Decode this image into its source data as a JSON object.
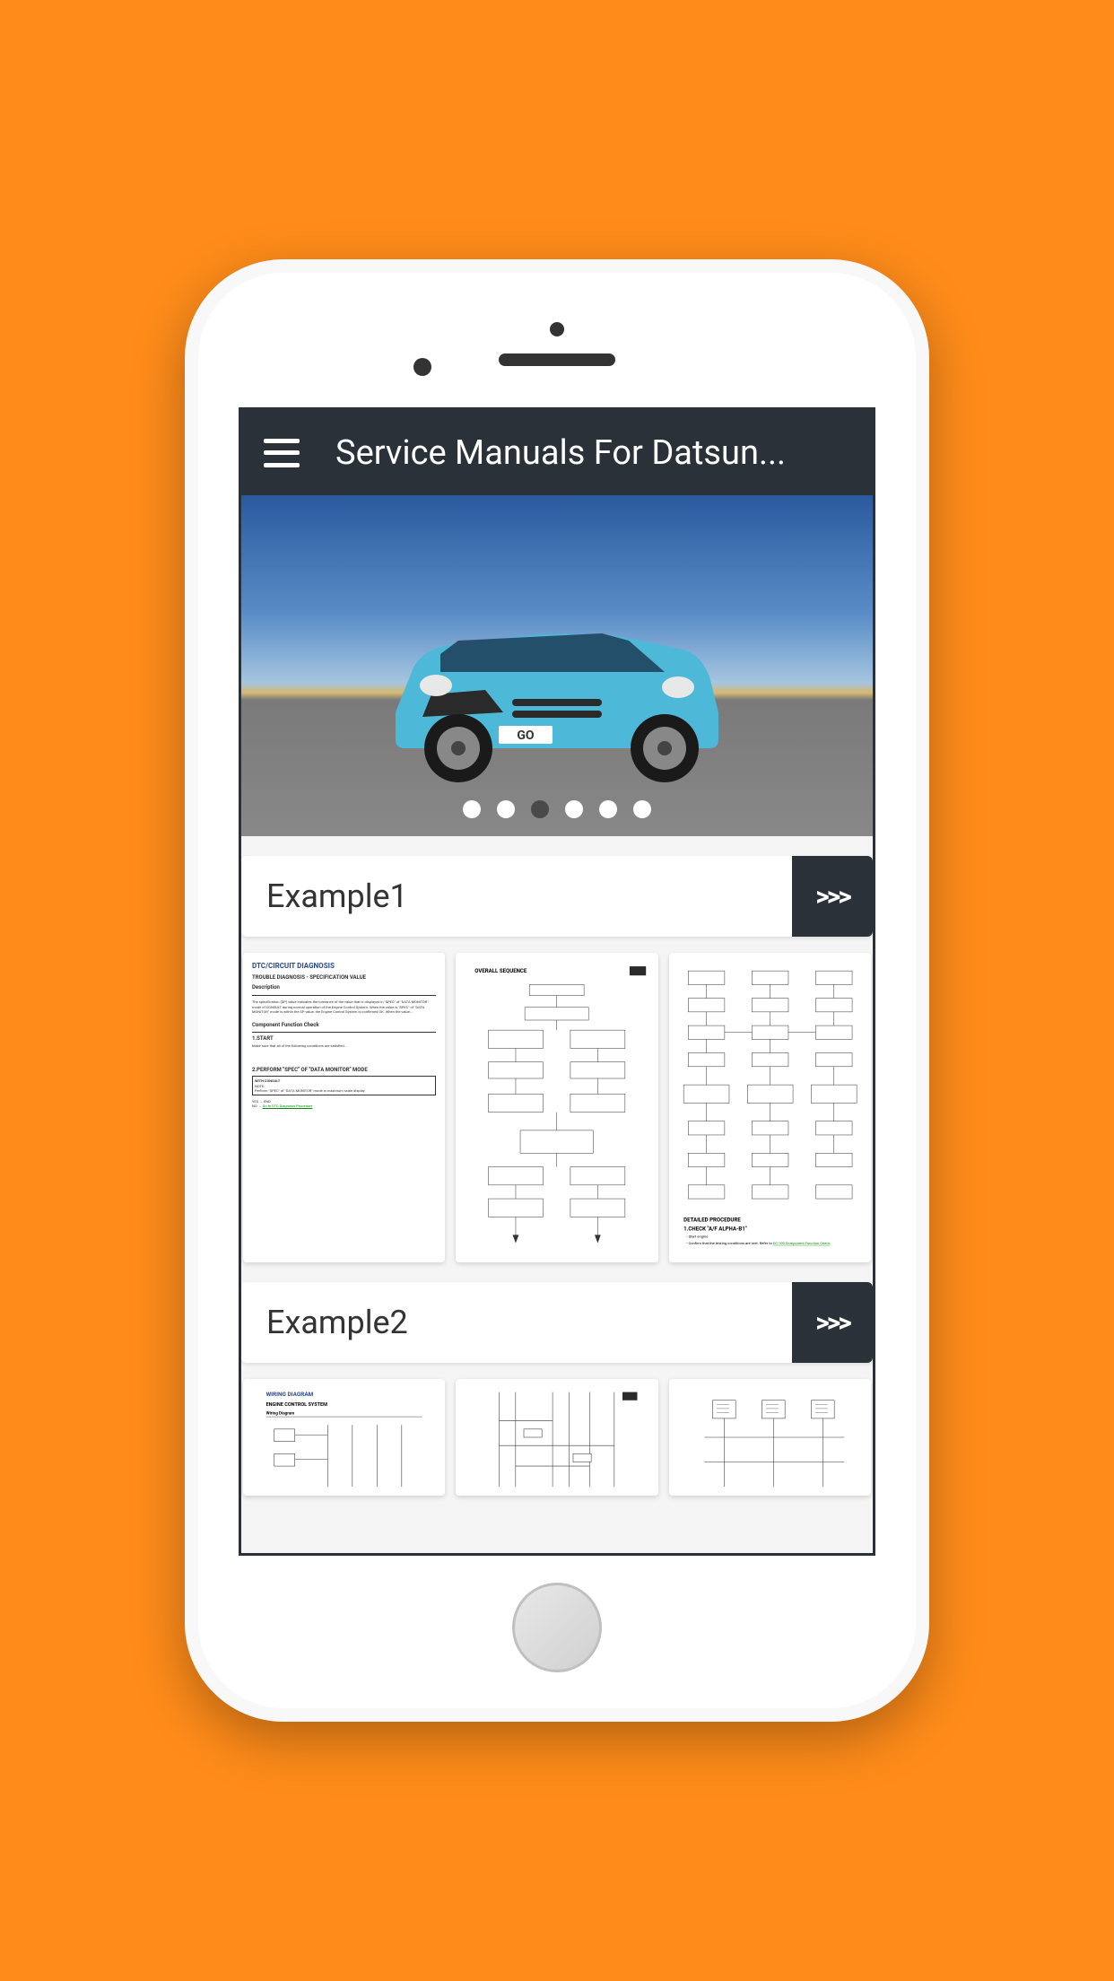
{
  "header": {
    "title": "Service Manuals For Datsun..."
  },
  "carousel": {
    "dots_count": 6,
    "active_index": 2
  },
  "sections": [
    {
      "title": "Example1",
      "arrow": ">>>"
    },
    {
      "title": "Example2",
      "arrow": ">>>"
    }
  ]
}
